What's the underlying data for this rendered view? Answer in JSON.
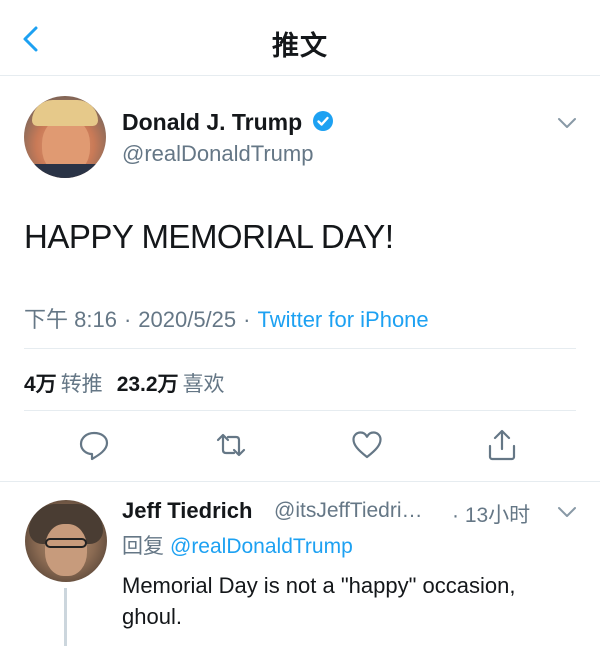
{
  "nav": {
    "title": "推文",
    "back_icon": "chevron-left-icon"
  },
  "tweet": {
    "author": {
      "name": "Donald J. Trump",
      "handle": "@realDonaldTrump",
      "verified": true
    },
    "text": "HAPPY MEMORIAL DAY!",
    "time": "下午 8:16",
    "date": "2020/5/25",
    "separator": "·",
    "source": "Twitter for iPhone",
    "stats": {
      "retweets_count": "4万",
      "retweets_label": "转推",
      "likes_count": "23.2万",
      "likes_label": "喜欢"
    },
    "actions": [
      "reply-icon",
      "retweet-icon",
      "like-icon",
      "share-icon"
    ]
  },
  "reply": {
    "author": {
      "name": "Jeff Tiedrich",
      "handle": "@itsJeffTiedri…"
    },
    "time": "· 13小时",
    "reply_label": "回复",
    "reply_to": "@realDonaldTrump",
    "text": "Memorial Day is not a \"happy\" occasion, ghoul."
  },
  "colors": {
    "accent": "#1da1f2",
    "secondary_text": "#657786",
    "primary_text": "#14171a",
    "divider": "#e6ecf0"
  }
}
